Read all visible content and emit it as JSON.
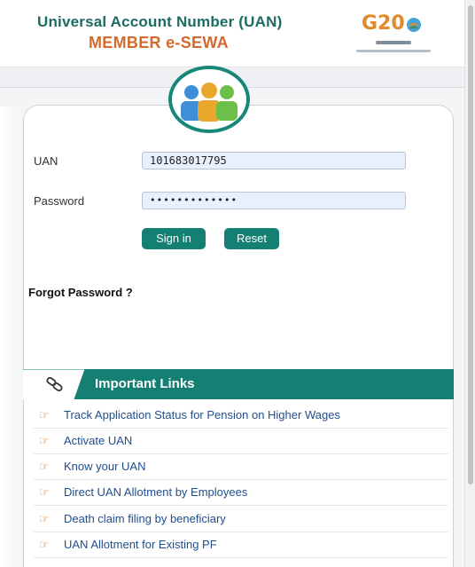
{
  "header": {
    "title_line1": "Universal Account Number (UAN)",
    "title_line2": "MEMBER e-SEWA",
    "g20_logo_text": "G20",
    "colors": {
      "teal": "#1c6b62",
      "orange": "#d46a2c"
    }
  },
  "login": {
    "uan_label": "UAN",
    "uan_value": "101683017795",
    "password_label": "Password",
    "password_value": "•••••••••••••",
    "signin_label": "Sign in",
    "reset_label": "Reset",
    "forgot_label": "Forgot Password ?"
  },
  "links": {
    "title": "Important Links",
    "items": [
      "Track Application Status for Pension on Higher Wages",
      "Activate UAN",
      "Know your UAN",
      "Direct UAN Allotment by Employees",
      "Death claim filing by beneficiary",
      "UAN Allotment for Existing PF"
    ],
    "item_icon": "hand-pointing-icon",
    "header_color": "#147f73"
  }
}
